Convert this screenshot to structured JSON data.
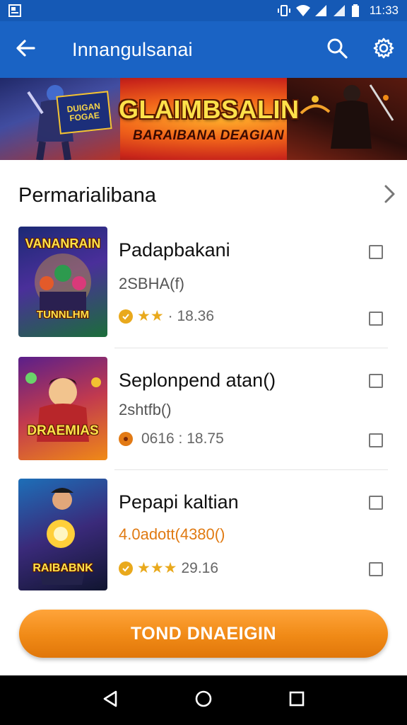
{
  "status_bar": {
    "time": "11:33"
  },
  "app_bar": {
    "title": "Innangulsanai"
  },
  "banner": {
    "badge_line1": "DUIGAN",
    "badge_line2": "FOGAE",
    "title": "GLAIMBSALIN",
    "subtitle": "BARAIBANA DEAGIAN"
  },
  "section": {
    "title": "Permarialibana"
  },
  "items": [
    {
      "thumb_label_top": "VANANRAIN",
      "thumb_label_bottom": "TUNNLHM",
      "title": "Padapbakani",
      "subtitle": "2SBHA(f)",
      "meta": "· 18.36",
      "stars": "★★"
    },
    {
      "thumb_label_top": "",
      "thumb_label_bottom": "DRAEMIAS",
      "title": "Seplonpend atan()",
      "subtitle": "2shtfb()",
      "meta": "0616 : 18.75",
      "stars": ""
    },
    {
      "thumb_label_top": "",
      "thumb_label_bottom": "RAIBABNK",
      "title": "Pepapi kaltian",
      "subtitle": "4.0adott(4380()",
      "meta": "29.16",
      "stars": "★★★"
    }
  ],
  "cta": {
    "label": "TOND DNAEIGIN"
  },
  "colors": {
    "primary": "#1a63c4",
    "status_bar": "#1559b5",
    "accent": "#f08a16",
    "star": "#e9a91c"
  }
}
